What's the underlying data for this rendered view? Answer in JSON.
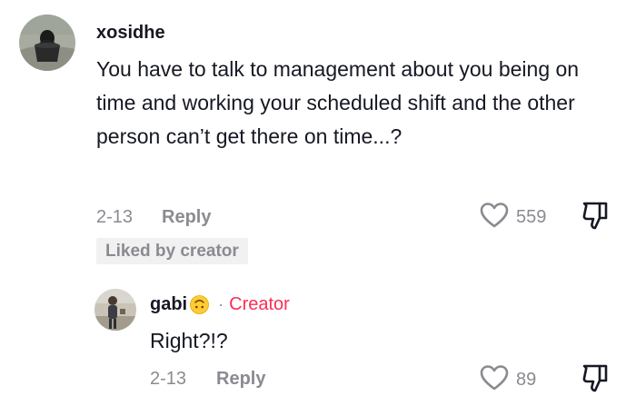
{
  "comment": {
    "username": "xosidhe",
    "text": "You have to talk to management about you being on time and working your scheduled shift and the other person can’t get there on time...?",
    "date": "2-13",
    "reply_label": "Reply",
    "like_count": "559",
    "badge": "Liked by creator"
  },
  "reply": {
    "username": "gabi",
    "separator": "·",
    "creator_label": "Creator",
    "text": "Right?!?",
    "date": "2-13",
    "reply_label": "Reply",
    "like_count": "89"
  },
  "icons": {
    "like": "heart-outline-icon",
    "dislike": "thumbs-down-outline-icon",
    "emoji": "upside-down-face-emoji"
  },
  "colors": {
    "text_primary": "#161823",
    "text_secondary": "#8a8b91",
    "creator_accent": "#fe2c55",
    "badge_background": "#f1f1f2"
  }
}
